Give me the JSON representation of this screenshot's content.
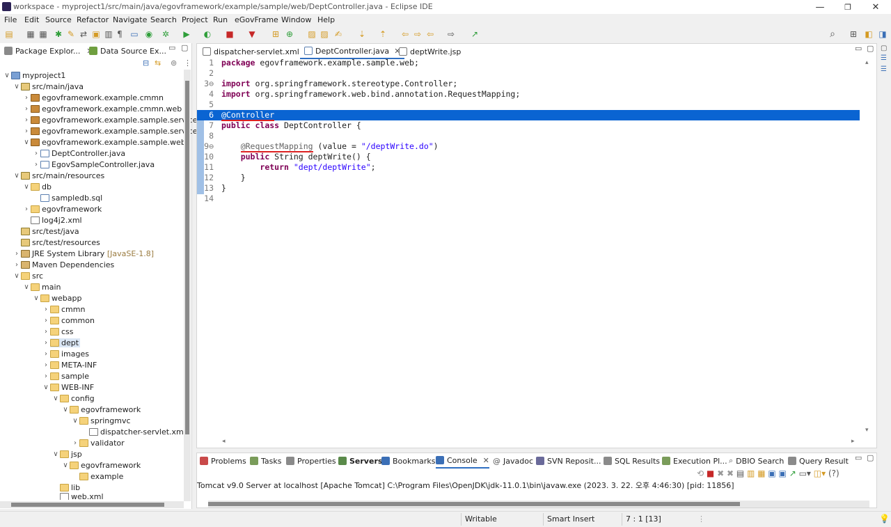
{
  "window": {
    "title": "workspace - myproject1/src/main/java/egovframework/example/sample/web/DeptController.java - Eclipse IDE",
    "minimize": "—",
    "maximize": "❐",
    "close": "✕"
  },
  "menu": [
    "File",
    "Edit",
    "Source",
    "Refactor",
    "Navigate",
    "Search",
    "Project",
    "Run",
    "eGovFrame",
    "Window",
    "Help"
  ],
  "left_tabs": [
    {
      "label": "Package Explor...",
      "close": "✕"
    },
    {
      "label": "Data Source Ex..."
    }
  ],
  "tree": [
    {
      "label": "myproject1"
    },
    {
      "label": "src/main/java"
    },
    {
      "label": "egovframework.example.cmmn"
    },
    {
      "label": "egovframework.example.cmmn.web"
    },
    {
      "label": "egovframework.example.sample.service"
    },
    {
      "label": "egovframework.example.sample.service.im"
    },
    {
      "label": "egovframework.example.sample.web"
    },
    {
      "label": "DeptController.java"
    },
    {
      "label": "EgovSampleController.java"
    },
    {
      "label": "src/main/resources"
    },
    {
      "label": "db"
    },
    {
      "label": "sampledb.sql"
    },
    {
      "label": "egovframework"
    },
    {
      "label": "log4j2.xml"
    },
    {
      "label": "src/test/java"
    },
    {
      "label": "src/test/resources"
    },
    {
      "label": "JRE System Library",
      "extra": "[JavaSE-1.8]"
    },
    {
      "label": "Maven Dependencies"
    },
    {
      "label": "src"
    },
    {
      "label": "main"
    },
    {
      "label": "webapp"
    },
    {
      "label": "cmmn"
    },
    {
      "label": "common"
    },
    {
      "label": "css"
    },
    {
      "label": "dept"
    },
    {
      "label": "images"
    },
    {
      "label": "META-INF"
    },
    {
      "label": "sample"
    },
    {
      "label": "WEB-INF"
    },
    {
      "label": "config"
    },
    {
      "label": "egovframework"
    },
    {
      "label": "springmvc"
    },
    {
      "label": "dispatcher-servlet.xml"
    },
    {
      "label": "validator"
    },
    {
      "label": "jsp"
    },
    {
      "label": "egovframework"
    },
    {
      "label": "example"
    },
    {
      "label": "lib"
    },
    {
      "label": "web.xml"
    }
  ],
  "editor_tabs": [
    {
      "label": "dispatcher-servlet.xml"
    },
    {
      "label": "DeptController.java",
      "close": "✕"
    },
    {
      "label": "deptWrite.jsp"
    }
  ],
  "code": {
    "l1": {
      "n": "1",
      "kw": "package",
      "rest": " egovframework.example.sample.web;"
    },
    "l2": {
      "n": "2"
    },
    "l3": {
      "n": "3⊖",
      "kw": "import",
      "rest": " org.springframework.stereotype.Controller;"
    },
    "l4": {
      "n": "4",
      "kw": "import",
      "rest": " org.springframework.web.bind.annotation.RequestMapping;"
    },
    "l5": {
      "n": "5"
    },
    "l6": {
      "n": "6",
      "ann": "@Controller"
    },
    "l7": {
      "n": "7",
      "kw1": "public",
      "kw2": "class",
      "rest": " DeptController {"
    },
    "l8": {
      "n": "8"
    },
    "l9": {
      "n": "9⊖",
      "ann": "@RequestMapping",
      "mid": " (value = ",
      "str": "\"/deptWrite.do\"",
      "end": ")"
    },
    "l10": {
      "n": "10",
      "kw": "public",
      "rest": " String deptWrite() {"
    },
    "l11": {
      "n": "11",
      "kw": "return",
      "str": "\"dept/deptWrite\"",
      "end": ";"
    },
    "l12": {
      "n": "12",
      "rest": "}"
    },
    "l13": {
      "n": "13",
      "rest": "}"
    },
    "l14": {
      "n": "14"
    }
  },
  "console_tabs": [
    {
      "label": "Problems"
    },
    {
      "label": "Tasks"
    },
    {
      "label": "Properties"
    },
    {
      "label": "Servers"
    },
    {
      "label": "Bookmarks"
    },
    {
      "label": "Console",
      "close": "✕"
    },
    {
      "label": "Javadoc",
      "prefix": "@"
    },
    {
      "label": "SVN Reposit..."
    },
    {
      "label": "SQL Results"
    },
    {
      "label": "Execution Pl..."
    },
    {
      "label": "DBIO Search"
    },
    {
      "label": "Query Result"
    }
  ],
  "console_text": "Tomcat v9.0 Server at localhost [Apache Tomcat] C:\\Program Files\\OpenJDK\\jdk-11.0.1\\bin\\javaw.exe  (2023. 3. 22. 오후 4:46:30) [pid: 11856]",
  "status": {
    "writable": "Writable",
    "insert": "Smart Insert",
    "position": "7 : 1 [13]",
    "dots": "⋮"
  }
}
